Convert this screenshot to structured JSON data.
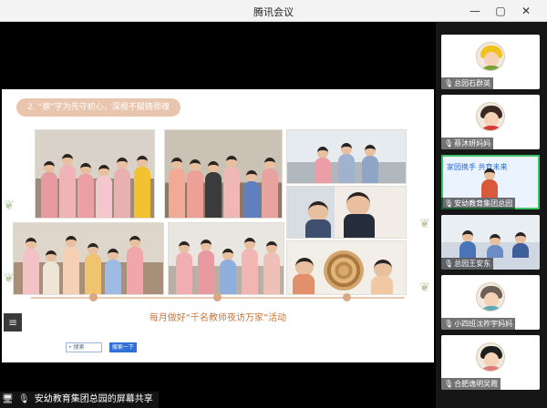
{
  "window": {
    "title": "腾讯会议",
    "minimize_glyph": "—",
    "maximize_glyph": "▢",
    "close_glyph": "✕"
  },
  "slide": {
    "heading": "2. “德”字为先守初心，深根不辍铸师魂",
    "caption": "每月做好“千名教师夜访万家”活动",
    "mini_input_placeholder": "• 搜索",
    "mini_button": "搜索一下"
  },
  "share_label": "安幼教育集团总园的屏幕共享",
  "menu_glyph": "≡",
  "participants": [
    {
      "name": "总园石群英",
      "mic": "🎙"
    },
    {
      "name": "蔡沐妍妈妈",
      "mic": "🎙"
    },
    {
      "name": "安幼教育集团总园",
      "mic": "🎙",
      "banner_text": "家园携手 共育未来"
    },
    {
      "name": "总园王安东",
      "mic": "🎙"
    },
    {
      "name": "小四班沈祚宇妈妈",
      "mic": "🎙"
    },
    {
      "name": "合肥逸明吴霞",
      "mic": "🎙"
    }
  ],
  "colors": {
    "heading_bg": "#e9c5ad",
    "caption": "#c9773d",
    "accent_blue": "#2f6fd6"
  }
}
